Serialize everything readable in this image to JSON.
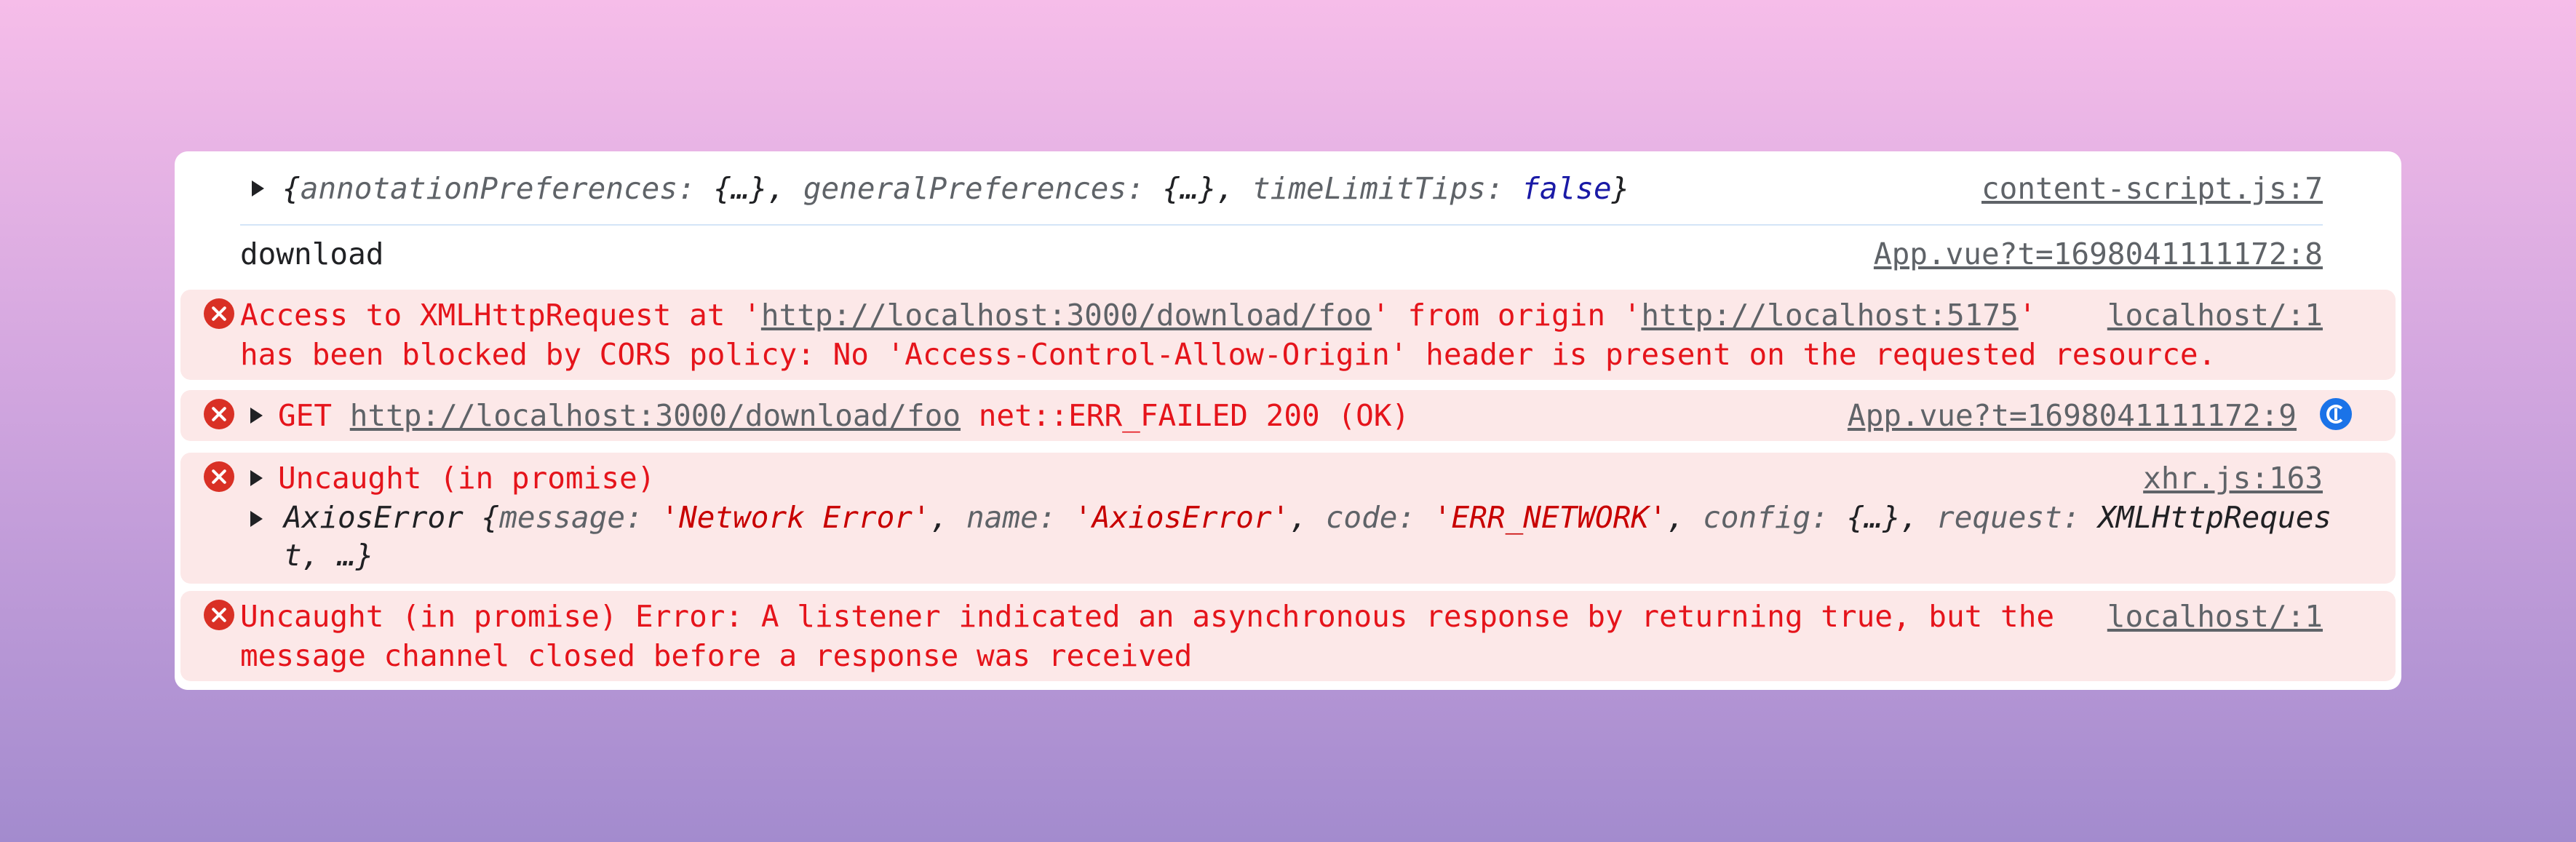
{
  "messages": {
    "log1": {
      "brace_open": "{",
      "k1": "annotationPreferences:",
      "v1": " {…}, ",
      "k2": "generalPreferences:",
      "v2": " {…}, ",
      "k3": "timeLimitTips:",
      "v3": " false",
      "brace_close": "}",
      "source": "content-script.js:7"
    },
    "log2": {
      "text": "download",
      "source": "App.vue?t=1698041111172:8"
    },
    "err1": {
      "line1_a": "Access to XMLHttpRequest at '",
      "url1": "http://localhost:3000/download/foo",
      "line1_b": "' from origin '",
      "url2": "http://localhost:5175",
      "line1_c": "'",
      "line2": "has been blocked by CORS policy: No 'Access-Control-Allow-Origin' header is present on the requested resource.",
      "source": "localhost/:1"
    },
    "err2": {
      "method": "GET ",
      "url": "http://localhost:3000/download/foo",
      "status": " net::ERR_FAILED 200 (OK)",
      "source": "App.vue?t=1698041111172:9"
    },
    "err3": {
      "title": "Uncaught (in promise)",
      "source": "xhr.js:163",
      "obj_name": "AxiosError",
      "k_message": "message:",
      "v_message": "'Network Error'",
      "k_name": "name:",
      "v_name": "'AxiosError'",
      "k_code": "code:",
      "v_code": "'ERR_NETWORK'",
      "k_config": "config:",
      "v_config": " {…}, ",
      "k_request": "request:",
      "v_request": " XMLHttpReques",
      "wrap": "t, …}"
    },
    "err4": {
      "line1": "Uncaught (in promise) Error: A listener indicated an asynchronous response by returning true, but the",
      "line2": "message channel closed before a response was received",
      "source": "localhost/:1"
    }
  },
  "colors": {
    "error_text": "#e5141b",
    "error_bg": "#fce8e8",
    "error_icon": "#d93025",
    "link": "#5f6368",
    "keyword": "#1a1aa6",
    "string": "#c80000",
    "sync_icon": "#1a73e8"
  },
  "icons": [
    "error-icon",
    "expand-triangle-icon",
    "sync-icon"
  ]
}
